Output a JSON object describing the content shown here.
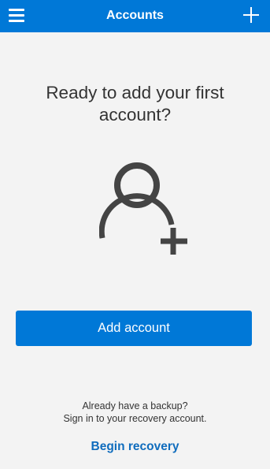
{
  "header": {
    "title": "Accounts",
    "menu_icon": "hamburger-menu-icon",
    "add_icon": "plus-icon"
  },
  "main": {
    "headline": "Ready to add your first account?",
    "illustration_icon": "add-person-icon",
    "add_account_label": "Add account",
    "backup_line_1": "Already have a backup?",
    "backup_line_2": "Sign in to your recovery account.",
    "recovery_link": "Begin recovery"
  },
  "colors": {
    "accent": "#0078d7",
    "background": "#f3f3f3",
    "text": "#333333",
    "link": "#0f6cbd"
  }
}
